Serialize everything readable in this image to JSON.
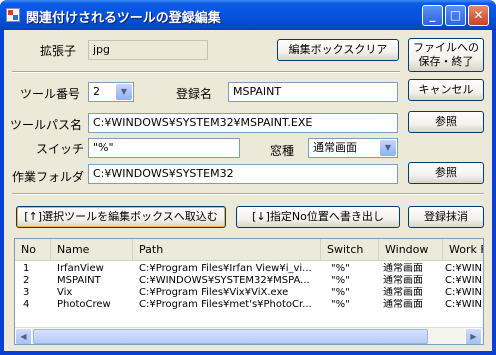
{
  "window": {
    "title": "関連付けされるツールの登録編集"
  },
  "extension": {
    "label": "拡張子",
    "value": "jpg"
  },
  "buttons": {
    "clear_edit": "編集ボックスクリア",
    "save_exit": "ファイルへの保存・終了",
    "cancel": "キャンセル",
    "browse_path": "参照",
    "browse_folder": "参照",
    "load_selected": "[↑]選択ツールを編集ボックスへ取込む",
    "write_to_pos": "[↓]指定No位置へ書き出し",
    "delete": "登録抹消"
  },
  "tool_number": {
    "label": "ツール番号",
    "value": "2"
  },
  "reg_name": {
    "label": "登録名",
    "value": "MSPAINT"
  },
  "tool_path": {
    "label": "ツールパス名",
    "value": "C:¥WINDOWS¥SYSTEM32¥MSPAINT.EXE"
  },
  "switch": {
    "label": "スイッチ",
    "value": "\"%\""
  },
  "window_type": {
    "label": "窓種",
    "value": "通常画面"
  },
  "work_folder": {
    "label": "作業フォルダ",
    "value": "C:¥WINDOWS¥SYSTEM32"
  },
  "list": {
    "columns": [
      "No",
      "Name",
      "Path",
      "Switch",
      "Window",
      "Work F"
    ],
    "rows": [
      [
        "1",
        "IrfanView",
        "C:¥Program Files¥Irfan View¥i_vi...",
        "\"%\"",
        "通常画面",
        "C:¥WIND"
      ],
      [
        "2",
        "MSPAINT",
        "C:¥WINDOWS¥SYSTEM32¥MSPA...",
        "\"%\"",
        "通常画面",
        "C:¥WIND"
      ],
      [
        "3",
        "Vix",
        "C:¥Program Files¥Vix¥ViX.exe",
        "\"%\"",
        "通常画面",
        "C:¥WIND"
      ],
      [
        "4",
        "PhotoCrew",
        "C:¥Program Files¥met's¥PhotoCr...",
        "\"%\"",
        "通常画面",
        "C:¥WIND"
      ]
    ]
  },
  "icons": {
    "app": "app-icon",
    "minimize": "minimize-icon",
    "maximize": "maximize-icon",
    "close": "close-icon",
    "dropdown": "chevron-down-icon",
    "scroll_left": "arrow-left-icon",
    "scroll_right": "arrow-right-icon"
  }
}
